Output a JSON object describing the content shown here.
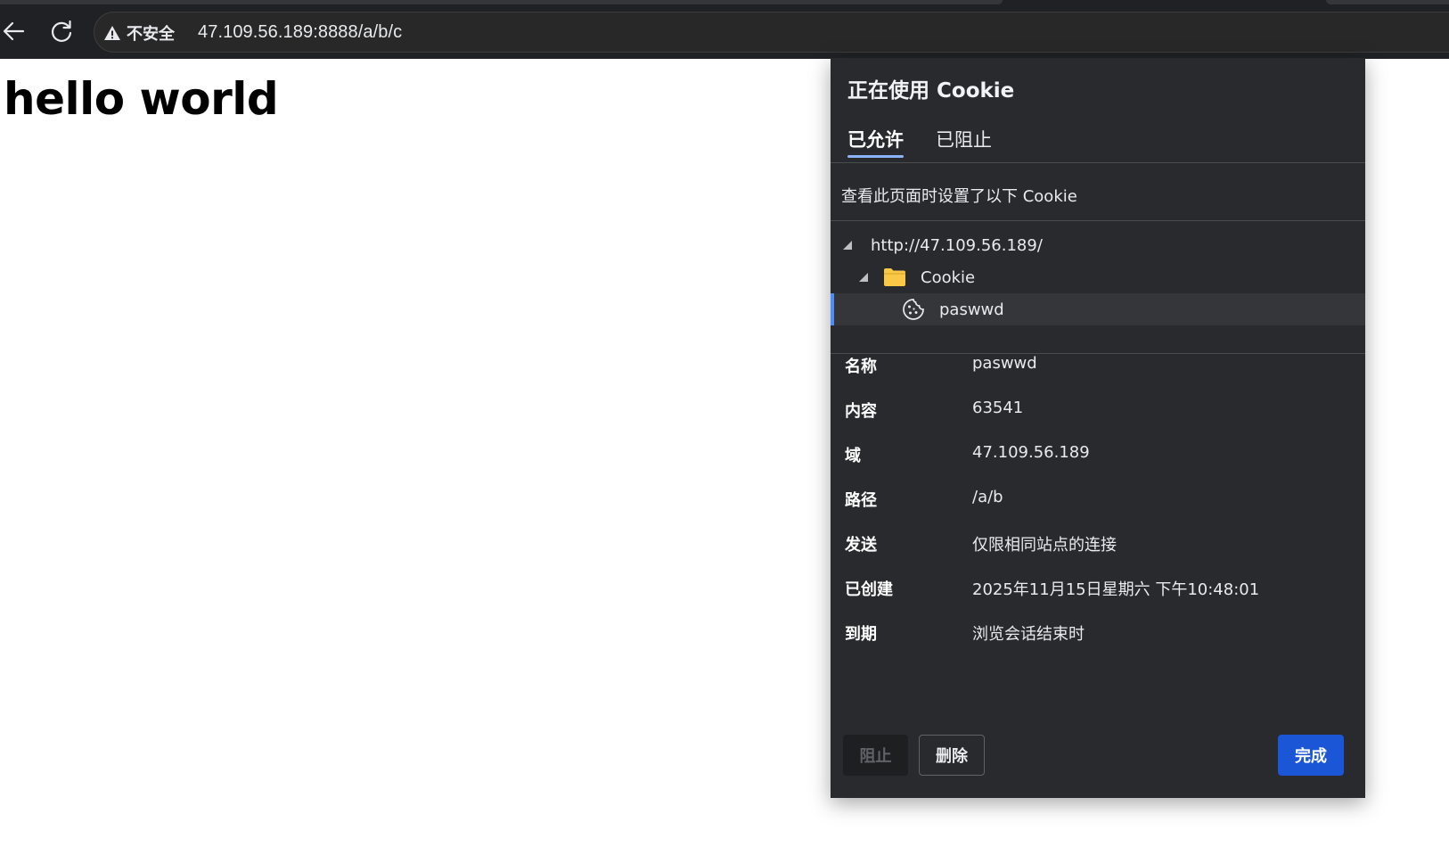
{
  "browser": {
    "security_label": "不安全",
    "url": "47.109.56.189:8888/a/b/c"
  },
  "page": {
    "heading": "hello world"
  },
  "cookie_popup": {
    "title": "正在使用 Cookie",
    "tabs": [
      {
        "label": "已允许",
        "active": true
      },
      {
        "label": "已阻止",
        "active": false
      }
    ],
    "description": "查看此页面时设置了以下 Cookie",
    "tree": {
      "site": "http://47.109.56.189/",
      "folder": "Cookie",
      "cookie": "paswwd"
    },
    "details": [
      {
        "label": "名称",
        "value": "paswwd"
      },
      {
        "label": "内容",
        "value": "63541"
      },
      {
        "label": "域",
        "value": "47.109.56.189"
      },
      {
        "label": "路径",
        "value": "/a/b"
      },
      {
        "label": "发送",
        "value": "仅限相同站点的连接"
      },
      {
        "label": "已创建",
        "value": "2025年11月15日星期六 下午10:48:01"
      },
      {
        "label": "到期",
        "value": "浏览会话结束时"
      }
    ],
    "buttons": {
      "block": "阻止",
      "delete": "删除",
      "done": "完成"
    }
  },
  "icons": {
    "back": "arrow-left-icon",
    "reload": "reload-icon",
    "warning": "warning-triangle-icon",
    "folder": "folder-icon",
    "cookie": "cookie-icon",
    "expander": "triangle-expander-icon"
  },
  "colors": {
    "accent_blue": "#1a56d6",
    "folder_yellow": "#f9c847",
    "popup_bg": "#292a2d",
    "toolbar_bg": "#202124"
  }
}
